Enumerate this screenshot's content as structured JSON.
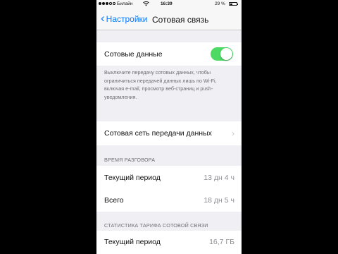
{
  "status_bar": {
    "carrier": "Билайн",
    "time": "16:39",
    "battery_percent": "29 %",
    "signal_bars": 3
  },
  "nav": {
    "back_label": "Настройки",
    "title": "Сотовая связь"
  },
  "cellular_data": {
    "label": "Сотовые данные",
    "enabled": true,
    "toggle_color": "#4cd964",
    "footnote": "Выключите передачу сотовых данных, чтобы ограничиться передачей данных лишь по Wi-Fi, включая e-mail, просмотр веб-страниц и push-уведомления."
  },
  "network_row": {
    "label": "Сотовая сеть передачи данных"
  },
  "call_time": {
    "header": "ВРЕМЯ РАЗГОВОРА",
    "rows": [
      {
        "label": "Текущий период",
        "value": "13 дн 4 ч"
      },
      {
        "label": "Всего",
        "value": "18 дн 5 ч"
      }
    ]
  },
  "tariff_stats": {
    "header": "СТАТИСТИКА ТАРИФА СОТОВОЙ СВЯЗИ",
    "rows": [
      {
        "label": "Текущий период",
        "value": "16,7 ГБ"
      }
    ]
  },
  "colors": {
    "accent": "#0a7aff",
    "background": "#efeff4"
  }
}
